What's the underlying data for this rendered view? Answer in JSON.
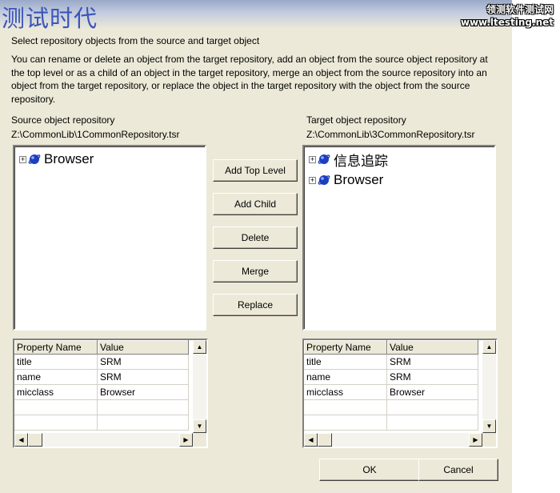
{
  "watermark": {
    "title": "测试时代",
    "site_name": "领测软件测试网",
    "site_url": "www.ltesting.net"
  },
  "intro": {
    "line1": "Select repository objects from the source and target object",
    "line2": "You can rename or delete an object from the target repository, add an object from the source object repository at the top level or as a child of an object in the target repository, merge an object from the source repository into an object from the target repository, or replace the object in the target repository with the object from the source repository."
  },
  "source": {
    "label": "Source object repository",
    "path": "Z:\\CommonLib\\1CommonRepository.tsr",
    "tree": [
      {
        "label": "Browser",
        "icon": "browser-object-icon"
      }
    ],
    "grid": {
      "headers": [
        "Property Name",
        "Value"
      ],
      "rows": [
        [
          "title",
          "SRM"
        ],
        [
          "name",
          "SRM"
        ],
        [
          "micclass",
          "Browser"
        ]
      ]
    }
  },
  "target": {
    "label": "Target object repository",
    "path": "Z:\\CommonLib\\3CommonRepository.tsr",
    "tree": [
      {
        "label": "信息追踪",
        "icon": "browser-object-icon"
      },
      {
        "label": "Browser",
        "icon": "browser-object-icon"
      }
    ],
    "grid": {
      "headers": [
        "Property Name",
        "Value"
      ],
      "rows": [
        [
          "title",
          "SRM"
        ],
        [
          "name",
          "SRM"
        ],
        [
          "micclass",
          "Browser"
        ]
      ]
    }
  },
  "actions": {
    "add_top_level": "Add Top Level",
    "add_child": "Add Child",
    "delete": "Delete",
    "merge": "Merge",
    "replace": "Replace"
  },
  "footer": {
    "ok": "OK",
    "cancel": "Cancel"
  },
  "icons": {
    "scroll_up": "▲",
    "scroll_down": "▼",
    "scroll_left": "◀",
    "scroll_right": "▶"
  }
}
